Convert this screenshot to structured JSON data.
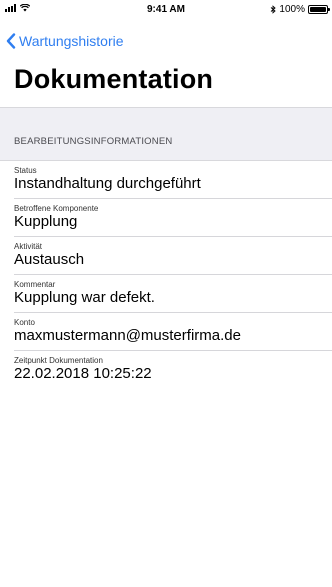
{
  "status_bar": {
    "time": "9:41 AM",
    "battery_text": "100%",
    "battery_level": 1.0,
    "icons": [
      "signal-icon",
      "wifi-icon",
      "bluetooth-icon",
      "battery-icon"
    ]
  },
  "nav": {
    "back_label": "Wartungshistorie",
    "back_icon": "chevron-left-icon"
  },
  "title": "Dokumentation",
  "section": {
    "header": "BEARBEITUNGSINFORMATIONEN"
  },
  "rows": [
    {
      "label": "Status",
      "value": "Instandhaltung durchgeführt"
    },
    {
      "label": "Betroffene Komponente",
      "value": "Kupplung"
    },
    {
      "label": "Aktivität",
      "value": "Austausch"
    },
    {
      "label": "Kommentar",
      "value": "Kupplung war defekt."
    },
    {
      "label": "Konto",
      "value": "maxmustermann@musterfirma.de"
    },
    {
      "label": "Zeitpunkt Dokumentation",
      "value": "22.02.2018 10:25:22"
    }
  ],
  "colors": {
    "accent": "#2f7ef0",
    "section_background": "#efeff4",
    "separator": "#d6d6da"
  }
}
